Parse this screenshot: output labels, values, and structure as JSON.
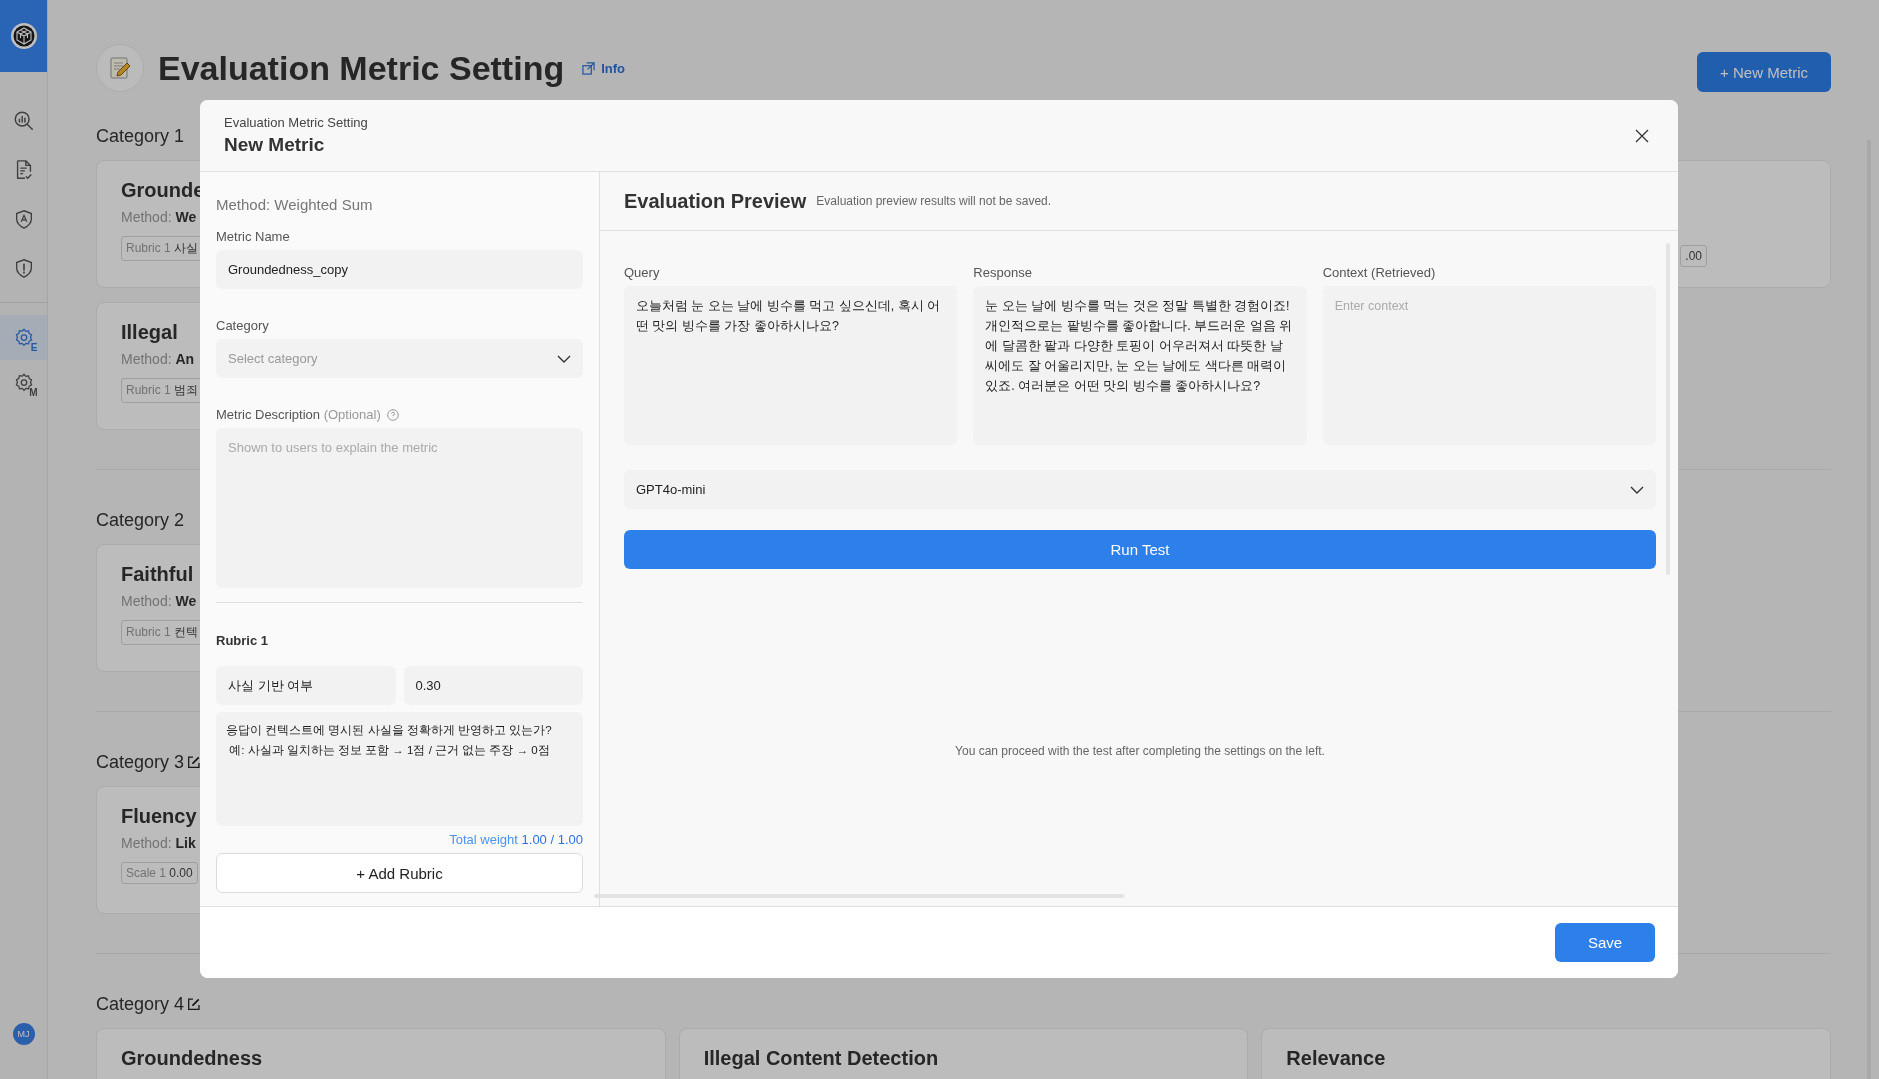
{
  "sidebar": {
    "items": [
      {
        "kind": "chart-search",
        "selected": false
      },
      {
        "kind": "document-check",
        "selected": false
      },
      {
        "kind": "shield-text",
        "selected": false
      },
      {
        "kind": "shield-alert",
        "selected": false
      },
      {
        "kind": "gear",
        "badge": "E",
        "selected": true
      },
      {
        "kind": "gear",
        "badge": "M",
        "selected": false
      }
    ],
    "avatar": "MJ"
  },
  "page": {
    "title": "Evaluation Metric Setting",
    "info_link": "Info",
    "new_metric_button": "+ New Metric",
    "categories": [
      {
        "name": "Category 1",
        "editable": false,
        "cards": [
          {
            "title": "Grounde",
            "method_label": "Method:",
            "method": "We",
            "chip_label": "Rubric 1",
            "chip_value": "사실"
          },
          {
            "kind": "edge",
            "chip_value": ".00"
          },
          {
            "title": "Illegal",
            "method_label": "Method:",
            "method": "An",
            "chip_label": "Rubric 1",
            "chip_value": "범죄"
          }
        ]
      },
      {
        "name": "Category 2",
        "editable": false,
        "cards": [
          {
            "title": "Faithful",
            "method_label": "Method:",
            "method": "We",
            "chip_label": "Rubric 1",
            "chip_value": "컨텍"
          }
        ]
      },
      {
        "name": "Category 3",
        "editable": true,
        "cards": [
          {
            "title": "Fluency",
            "method_label": "Method:",
            "method": "Lik",
            "chip_label": "Scale 1",
            "chip_value": "0.00"
          }
        ]
      },
      {
        "name": "Category 4",
        "editable": true,
        "cards": [
          {
            "title": "Groundedness"
          },
          {
            "title": "Illegal Content Detection"
          },
          {
            "title": "Relevance"
          }
        ]
      }
    ]
  },
  "modal": {
    "breadcrumb": "Evaluation Metric Setting",
    "title": "New Metric",
    "form": {
      "method": "Method: Weighted Sum",
      "metric_name": {
        "label": "Metric Name",
        "value": "Groundedness_copy"
      },
      "category": {
        "label": "Category",
        "placeholder": "Select category"
      },
      "description": {
        "label": "Metric Description",
        "hint": "(Optional)",
        "placeholder": "Shown to users to explain the metric"
      },
      "rubrics": [
        {
          "title": "Rubric 1",
          "name": "사실 기반 여부",
          "weight": "0.30",
          "text": "응답이 컨텍스트에 명시된 사실을 정확하게 반영하고 있는가?\n 예: 사실과 일치하는 정보 포함 → 1점 / 근거 없는 주장 → 0점"
        }
      ],
      "total_weight": {
        "label": "Total weight",
        "value": "1.00 / 1.00"
      },
      "add_rubric_button": "+ Add Rubric"
    },
    "preview": {
      "title": "Evaluation Preview",
      "note": "Evaluation preview results will not be saved.",
      "fields": [
        {
          "label": "Query",
          "value": "오늘처럼 눈 오는 날에 빙수를 먹고 싶으신데, 혹시 어떤 맛의 빙수를 가장 좋아하시나요?"
        },
        {
          "label": "Response",
          "value": "눈 오는 날에 빙수를 먹는 것은 정말 특별한 경험이죠! 개인적으로는 팥빙수를 좋아합니다. 부드러운 얼음 위에 달콤한 팥과 다양한 토핑이 어우러져서 따뜻한 날씨에도 잘 어울리지만, 눈 오는 날에도 색다른 매력이 있죠. 여러분은 어떤 맛의 빙수를 좋아하시나요?"
        },
        {
          "label": "Context (Retrieved)",
          "placeholder": "Enter context"
        }
      ],
      "model": "GPT4o-mini",
      "run_button": "Run Test",
      "message": "You can proceed with the test after completing the settings on the left."
    },
    "save_button": "Save"
  }
}
